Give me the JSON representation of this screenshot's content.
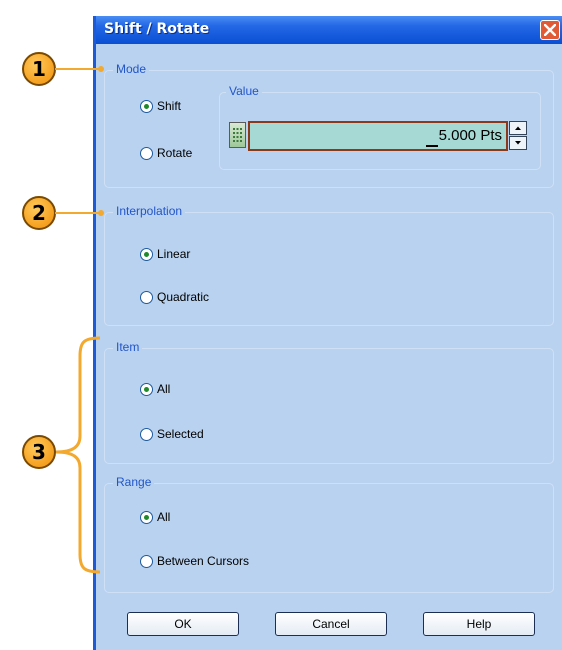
{
  "window": {
    "title": "Shift / Rotate",
    "close_icon": "close-icon"
  },
  "callouts": [
    "1",
    "2",
    "3"
  ],
  "mode": {
    "legend": "Mode",
    "options": [
      {
        "label": "Shift",
        "checked": true
      },
      {
        "label": "Rotate",
        "checked": false
      }
    ],
    "value": {
      "legend": "Value",
      "calculator_icon": "calculator-icon",
      "text": "5.000 Pts",
      "up_icon": "spin-up-icon",
      "down_icon": "spin-down-icon"
    }
  },
  "interpolation": {
    "legend": "Interpolation",
    "options": [
      {
        "label": "Linear",
        "checked": true
      },
      {
        "label": "Quadratic",
        "checked": false
      }
    ]
  },
  "item": {
    "legend": "Item",
    "options": [
      {
        "label": "All",
        "checked": true
      },
      {
        "label": "Selected",
        "checked": false
      }
    ]
  },
  "range": {
    "legend": "Range",
    "options": [
      {
        "label": "All",
        "checked": true
      },
      {
        "label": "Between Cursors",
        "checked": false
      }
    ]
  },
  "buttons": {
    "ok": "OK",
    "cancel": "Cancel",
    "help": "Help"
  },
  "colors": {
    "dialog_bg": "#b9d2f0",
    "titlebar": "#0a4fd4",
    "legend_text": "#2155c9",
    "callout": "#f5a01f",
    "value_field": "#a6d9d3"
  }
}
